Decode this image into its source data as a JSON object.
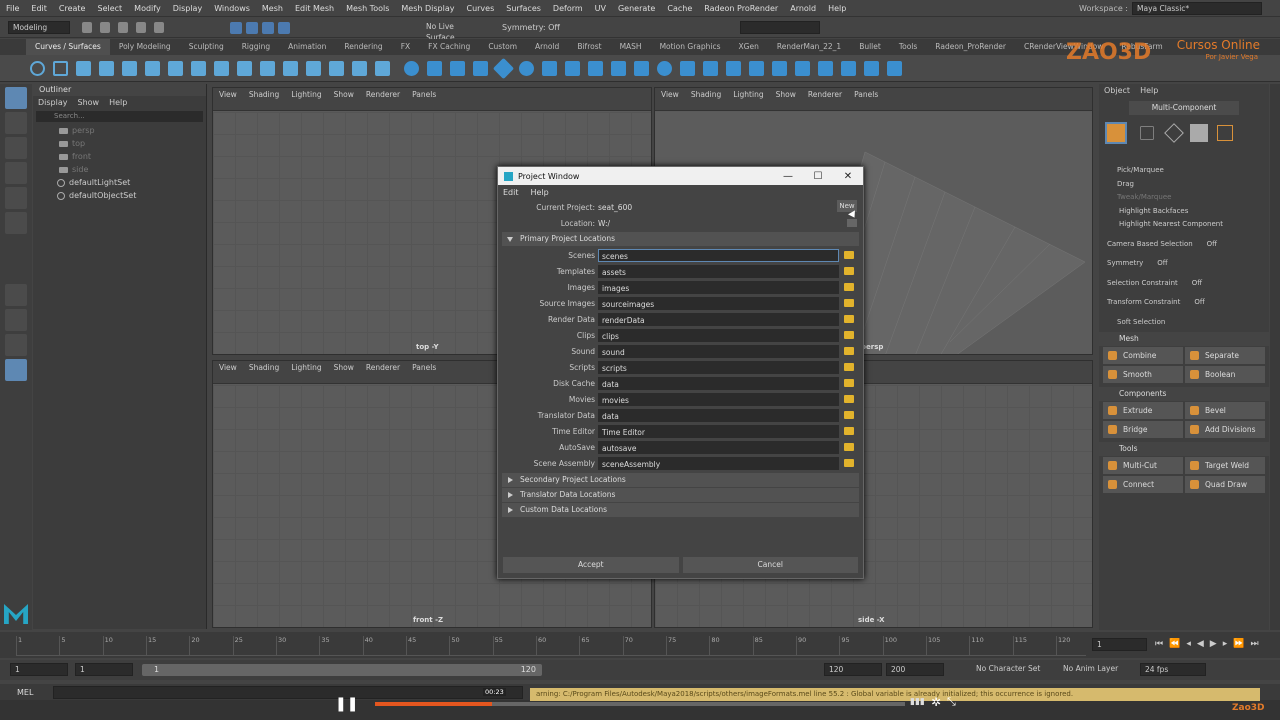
{
  "menubar": {
    "items": [
      "File",
      "Edit",
      "Create",
      "Select",
      "Modify",
      "Display",
      "Windows",
      "Mesh",
      "Edit Mesh",
      "Mesh Tools",
      "Mesh Display",
      "Curves",
      "Surfaces",
      "Deform",
      "UV",
      "Generate",
      "Cache",
      "Radeon ProRender",
      "Arnold",
      "Help"
    ],
    "workspace_label": "Workspace :",
    "workspace_value": "Maya Classic*"
  },
  "statusline": {
    "mode": "Modeling",
    "live_surface": "No Live Surface",
    "symmetry": "Symmetry: Off"
  },
  "shelf_tabs": [
    "Curves / Surfaces",
    "Poly Modeling",
    "Sculpting",
    "Rigging",
    "Animation",
    "Rendering",
    "FX",
    "FX Caching",
    "Custom",
    "Arnold",
    "Bifrost",
    "MASH",
    "Motion Graphics",
    "XGen",
    "RenderMan_22_1",
    "Bullet",
    "Tools",
    "Radeon_ProRender",
    "CRenderViewWindow",
    "RebusFarm"
  ],
  "brand": {
    "logo": "ZAO3D",
    "title": "Cursos Online",
    "author": "Por Javier Vega"
  },
  "outliner": {
    "title": "Outliner",
    "menu": [
      "Display",
      "Show",
      "Help"
    ],
    "search_placeholder": "Search...",
    "items": [
      {
        "label": "persp",
        "type": "cam"
      },
      {
        "label": "top",
        "type": "cam"
      },
      {
        "label": "front",
        "type": "cam"
      },
      {
        "label": "side",
        "type": "cam"
      },
      {
        "label": "defaultLightSet",
        "type": "set"
      },
      {
        "label": "defaultObjectSet",
        "type": "set"
      }
    ]
  },
  "viewport_menu": [
    "View",
    "Shading",
    "Lighting",
    "Show",
    "Renderer",
    "Panels"
  ],
  "viewports": {
    "top": "top -Y",
    "persp": "persp",
    "front": "front -Z",
    "side": "side -X"
  },
  "dialog": {
    "title": "Project Window",
    "menu": [
      "Edit",
      "Help"
    ],
    "current_project_label": "Current Project:",
    "current_project": "seat_600",
    "new_button": "New",
    "location_label": "Location:",
    "location": "W:/",
    "primary_section": "Primary Project Locations",
    "fields": [
      {
        "label": "Scenes",
        "value": "scenes"
      },
      {
        "label": "Templates",
        "value": "assets"
      },
      {
        "label": "Images",
        "value": "images"
      },
      {
        "label": "Source Images",
        "value": "sourceimages"
      },
      {
        "label": "Render Data",
        "value": "renderData"
      },
      {
        "label": "Clips",
        "value": "clips"
      },
      {
        "label": "Sound",
        "value": "sound"
      },
      {
        "label": "Scripts",
        "value": "scripts"
      },
      {
        "label": "Disk Cache",
        "value": "data"
      },
      {
        "label": "Movies",
        "value": "movies"
      },
      {
        "label": "Translator Data",
        "value": "data"
      },
      {
        "label": "Time Editor",
        "value": "Time Editor"
      },
      {
        "label": "AutoSave",
        "value": "autosave"
      },
      {
        "label": "Scene Assembly",
        "value": "sceneAssembly"
      }
    ],
    "sections": [
      "Secondary Project Locations",
      "Translator Data Locations",
      "Custom Data Locations"
    ],
    "accept": "Accept",
    "cancel": "Cancel"
  },
  "modeling_toolkit": {
    "menu": [
      "Object",
      "Help"
    ],
    "multi_component": "Multi-Component",
    "options": [
      "Pick/Marquee",
      "Drag",
      "Tweak/Marquee"
    ],
    "checks": [
      "Highlight Backfaces",
      "Highlight Nearest Component"
    ],
    "camera_based": "Camera Based Selection",
    "camera_based_val": "Off",
    "symmetry": "Symmetry",
    "symmetry_val": "Off",
    "selection_constraint": "Selection Constraint",
    "selection_constraint_val": "Off",
    "transform_constraint": "Transform Constraint",
    "transform_constraint_val": "Off",
    "soft_selection": "Soft Selection",
    "mesh_title": "Mesh",
    "mesh_buttons": [
      "Combine",
      "Separate",
      "Smooth",
      "Boolean"
    ],
    "components_title": "Components",
    "components_buttons": [
      "Extrude",
      "Bevel",
      "Bridge",
      "Add Divisions"
    ],
    "tools_title": "Tools",
    "tools_buttons": [
      "Multi-Cut",
      "Target Weld",
      "Connect",
      "Quad Draw"
    ]
  },
  "timeline": {
    "ticks": [
      "1",
      "5",
      "10",
      "15",
      "20",
      "25",
      "30",
      "35",
      "40",
      "45",
      "50",
      "55",
      "60",
      "65",
      "70",
      "75",
      "80",
      "85",
      "90",
      "95",
      "100",
      "105",
      "110",
      "115",
      "120"
    ],
    "current_frame": "1",
    "range_start": "1",
    "range_start2": "1",
    "range_inner_start": "1",
    "range_inner_end": "120",
    "range_end": "120",
    "anim_end": "200",
    "character_set": "No Character Set",
    "anim_layer": "No Anim Layer",
    "fps": "24 fps"
  },
  "cmdline": {
    "label": "MEL",
    "message": "arning: C:/Program Files/Autodesk/Maya2018/scripts/others/imageFormats.mel line 55.2 : Global variable is already initialized; this occurrence is ignored."
  },
  "video": {
    "time": "00:23",
    "progress": 0.22,
    "watermark": "Zao3D"
  },
  "colors": {
    "accent_orange": "#e47b2a",
    "folder": "#e2b32c",
    "highlight": "#5e88b3"
  }
}
